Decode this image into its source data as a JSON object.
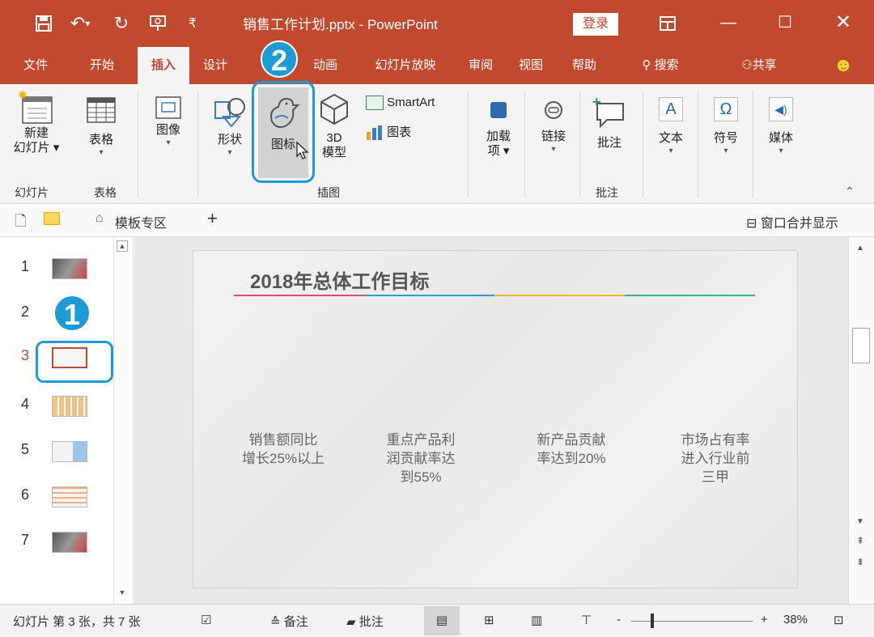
{
  "titlebar": {
    "doc_title": "销售工作计划.pptx  -  PowerPoint",
    "login": "登录",
    "icons": [
      "save-icon",
      "undo-icon",
      "redo-icon",
      "slideshow-icon",
      "customize-icon"
    ]
  },
  "tabs": [
    {
      "label": "文件"
    },
    {
      "label": "开始"
    },
    {
      "label": "插入"
    },
    {
      "label": "设计"
    },
    {
      "label": "动画"
    },
    {
      "label": "幻灯片放映"
    },
    {
      "label": "审阅"
    },
    {
      "label": "视图"
    },
    {
      "label": "帮助"
    },
    {
      "label": "搜索"
    },
    {
      "label": "共享"
    }
  ],
  "ribbon": {
    "new_slide": [
      "新建",
      "幻灯片"
    ],
    "table": "表格",
    "image": "图像",
    "shapes": "形状",
    "icons": "图标",
    "model_3d": [
      "3D",
      "模型"
    ],
    "smartart": "SmartArt",
    "chart": "图表",
    "addins": [
      "加载",
      "项"
    ],
    "links": "链接",
    "comment": "批注",
    "text": "文本",
    "symbols": "符号",
    "media": "媒体",
    "groups": {
      "slides": "幻灯片",
      "tables": "表格",
      "illustrations": "插图",
      "comments": "批注"
    }
  },
  "annotations": {
    "badge1": "1",
    "badge2": "2"
  },
  "quickbar": {
    "template_zone": "模板专区",
    "merge_windows": "窗口合并显示"
  },
  "thumbnails": [
    {
      "num": "1"
    },
    {
      "num": "2"
    },
    {
      "num": "3"
    },
    {
      "num": "4"
    },
    {
      "num": "5"
    },
    {
      "num": "6"
    },
    {
      "num": "7"
    }
  ],
  "slide": {
    "title": "2018年总体工作目标",
    "goals": [
      [
        "销售额同比",
        "增长25%以上"
      ],
      [
        "重点产品利",
        "润贡献率达",
        "到55%"
      ],
      [
        "新产品贡献",
        "率达到20%"
      ],
      [
        "市场占有率",
        "进入行业前",
        "三甲"
      ]
    ]
  },
  "status": {
    "slide_info": "幻灯片 第 3 张，共 7 张",
    "notes": "备注",
    "comments": "批注",
    "zoom": "38%"
  },
  "colors": {
    "accent": "#c0492e",
    "highlight": "#1d9bd7"
  }
}
